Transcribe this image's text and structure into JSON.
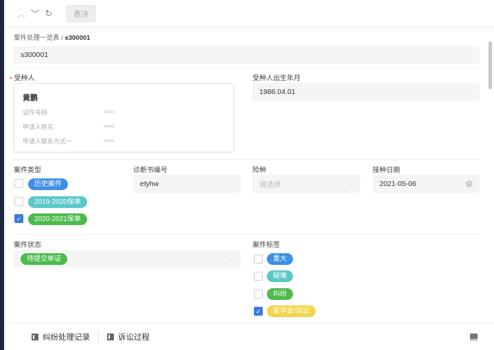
{
  "toolbar": {
    "action_label": "表决"
  },
  "breadcrumb": {
    "parent": "案件处理一览表",
    "separator": "/",
    "current": "s300001"
  },
  "case_number": {
    "value": "s300001"
  },
  "insured": {
    "label": "受种人",
    "name": "黄鹏",
    "fields": [
      "证件号码",
      "申请人姓名",
      "申请人联系方式一"
    ]
  },
  "birth": {
    "label": "受种人出生年月",
    "value": "1986.04.01"
  },
  "case_type": {
    "label": "案件类型",
    "options": [
      {
        "label": "历史案件",
        "checked": false,
        "color": "#3d8fe8"
      },
      {
        "label": "2019-2020保单",
        "checked": false,
        "color": "#5ac8c8"
      },
      {
        "label": "2020-2021保单",
        "checked": true,
        "color": "#4cbb4c"
      }
    ]
  },
  "diagnosis": {
    "label": "诊断书编号",
    "value": "etyhw"
  },
  "insurance": {
    "label": "险种",
    "placeholder": "请选择"
  },
  "vacc_date": {
    "label": "接种日期",
    "value": "2021-05-06"
  },
  "status": {
    "label": "案件状态",
    "value": "待提交单证",
    "color": "#4cbb4c"
  },
  "tags": {
    "label": "案件标签",
    "options": [
      {
        "label": "重大",
        "checked": false,
        "color": "#3d8fe8"
      },
      {
        "label": "疑难",
        "checked": false,
        "color": "#5ac8c8"
      },
      {
        "label": "纠纷",
        "checked": false,
        "color": "#4cbb4c"
      },
      {
        "label": "医学会/诉讼",
        "checked": true,
        "color": "#f2d54a"
      }
    ]
  },
  "footer": {
    "tabs": [
      "纠纷处理记录",
      "诉讼过程"
    ]
  }
}
